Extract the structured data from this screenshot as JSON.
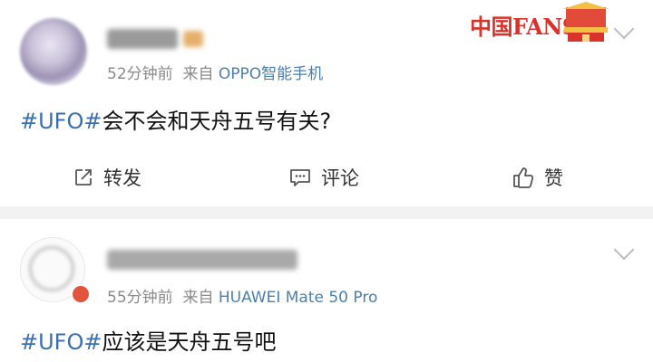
{
  "posts": [
    {
      "time": "52分钟前",
      "source_prefix": "来自",
      "source": "OPPO智能手机",
      "hashtag": "#UFO#",
      "text": "会不会和天舟五号有关?",
      "actions": {
        "repost": "转发",
        "comment": "评论",
        "like": "赞"
      },
      "icons": {
        "repost": "repost-icon",
        "comment": "comment-icon",
        "like": "thumbs-up-icon",
        "menu": "chevron-down-icon"
      }
    },
    {
      "time": "55分钟前",
      "source_prefix": "来自",
      "source": "HUAWEI Mate 50 Pro",
      "hashtag": "#UFO#",
      "text": "应该是天舟五号吧",
      "icons": {
        "menu": "chevron-down-icon",
        "badge": "verified-badge-icon"
      }
    }
  ],
  "watermark": {
    "text": "中国FANS"
  },
  "colors": {
    "link": "#3a6fb0",
    "meta": "#8a8a8a",
    "source": "#4d7fae",
    "divider": "#f2f2f2",
    "watermark": "#d8322a"
  }
}
